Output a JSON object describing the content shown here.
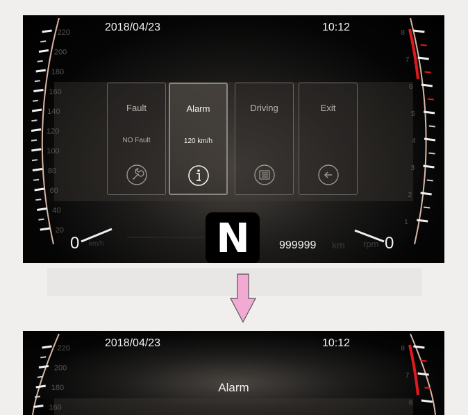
{
  "top_screen": {
    "date": "2018/04/23",
    "time": "10:12",
    "speed_gauge": {
      "ticks": [
        "220",
        "200",
        "180",
        "160",
        "140",
        "120",
        "100",
        "80",
        "60",
        "40",
        "20"
      ],
      "value": "0",
      "unit": "km/h"
    },
    "rpm_gauge": {
      "ticks": [
        "8",
        "7",
        "6",
        "5",
        "4",
        "3",
        "2",
        "1"
      ],
      "value": "0",
      "unit": "rpm"
    },
    "menu": [
      {
        "title": "Fault",
        "subtitle": "NO Fault",
        "icon": "wrench-icon",
        "selected": false
      },
      {
        "title": "Alarm",
        "subtitle": "120 km/h",
        "icon": "info-icon",
        "selected": true
      },
      {
        "title": "Driving",
        "subtitle": "",
        "icon": "list-icon",
        "selected": false
      },
      {
        "title": "Exit",
        "subtitle": "",
        "icon": "back-arrow-icon",
        "selected": false
      }
    ],
    "gear": "N",
    "odometer": "999999",
    "odometer_unit": "km"
  },
  "arrow": {
    "color": "#f2a9d4",
    "direction": "down"
  },
  "bottom_screen": {
    "date": "2018/04/23",
    "time": "10:12",
    "title": "Alarm",
    "speed_ticks": [
      "220",
      "200",
      "180",
      "160"
    ],
    "rpm_ticks": [
      "8",
      "7",
      "6"
    ]
  },
  "colors": {
    "redline": "#e0191e",
    "bezel": "#d8b6a4",
    "text": "#f2f2f2"
  }
}
